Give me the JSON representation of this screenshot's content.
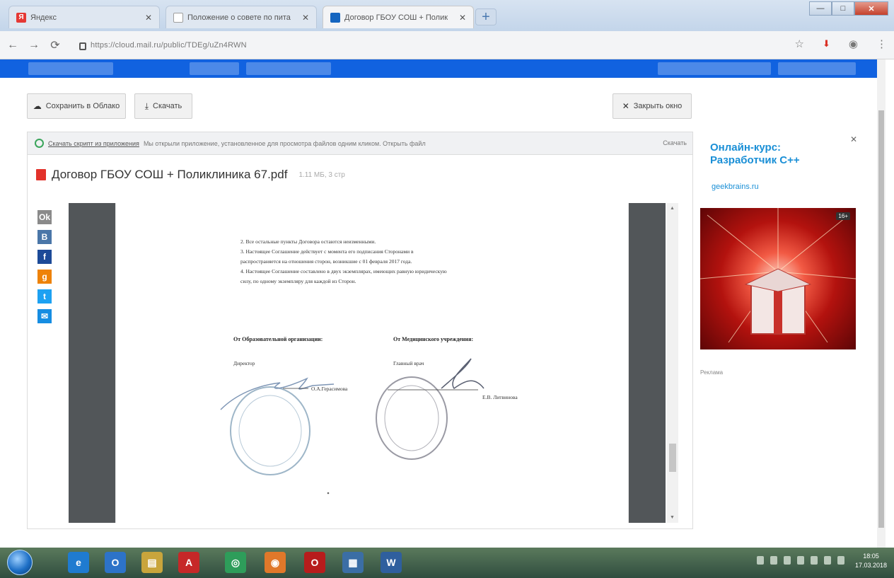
{
  "browser": {
    "tabs": [
      {
        "title": "Яндекс",
        "favicon_color": "#e53935",
        "favicon_text": "Я"
      },
      {
        "title": "Положение о совете по пита",
        "favicon_color": "#9e9e9e",
        "favicon_text": ""
      },
      {
        "title": "Договор ГБОУ СОШ + Полик",
        "favicon_color": "#1565c0",
        "favicon_text": ""
      }
    ],
    "new_tab_label": "+",
    "window_controls": {
      "minimize": "—",
      "maximize": "□",
      "close": "✕"
    },
    "url": "https://cloud.mail.ru/public/TDEg/uZn4RWN",
    "nav": {
      "back": "←",
      "forward": "→",
      "reload": "⟳"
    },
    "right_icons": {
      "star": "☆",
      "pdf": "⬇",
      "account": "◉",
      "menu": "⋮"
    }
  },
  "page": {
    "save_button": "Сохранить в Облако",
    "download_button": "Скачать",
    "close_button": "Закрыть окно",
    "notice": {
      "link": "Скачать скрипт из приложения",
      "text": "Мы открыли приложение, установленное для просмотра файлов одним кликом. Открыть файл",
      "right": "Скачать"
    },
    "file": {
      "name": "Договор ГБОУ СОШ + Поликлиника 67.pdf",
      "meta": "1.11 МБ, 3 стр"
    },
    "document": {
      "lines": [
        "2. Все остальные пункты Договора остаются неизменными.",
        "3. Настоящее Соглашение действует с момента его подписания Сторонами в",
        "распространяется на отношения сторон, возникшие с 01 февраля 2017 года.",
        "4. Настоящее Соглашение составлено в двух экземплярах, имеющих равную юридическую",
        "силу, по одному экземпляру для каждой из Сторон."
      ],
      "left_party_heading": "От Образовательной организации:",
      "left_role": "Директор",
      "left_signer": "О.А.Герасимова",
      "right_party_heading": "От Медицинского учреждения:",
      "right_role": "Главный врач",
      "right_signer": "Е.В. Литвинова"
    },
    "share_icons": [
      "Ok",
      "В",
      "f",
      "g",
      "t",
      "✉"
    ]
  },
  "ad": {
    "title": "Онлайн-курс: Разработчик С++",
    "domain": "geekbrains.ru",
    "badge": "16+",
    "label": "Реклама"
  },
  "taskbar": {
    "apps": [
      {
        "name": "ie",
        "color": "#1f7bd0",
        "glyph": "e"
      },
      {
        "name": "outlook",
        "color": "#2d73c8",
        "glyph": "O"
      },
      {
        "name": "explorer",
        "color": "#c9a53c",
        "glyph": "▤"
      },
      {
        "name": "acrobat",
        "color": "#c62828",
        "glyph": "A"
      },
      {
        "name": "chrome",
        "color": "#2e9d5a",
        "glyph": "◎"
      },
      {
        "name": "firefox",
        "color": "#e0782a",
        "glyph": "◉"
      },
      {
        "name": "opera",
        "color": "#b71c1c",
        "glyph": "O"
      },
      {
        "name": "calc",
        "color": "#3b6ea5",
        "glyph": "▦"
      },
      {
        "name": "word",
        "color": "#2f5f9e",
        "glyph": "W"
      }
    ],
    "clock_time": "18:05",
    "clock_date": "17.03.2018"
  }
}
